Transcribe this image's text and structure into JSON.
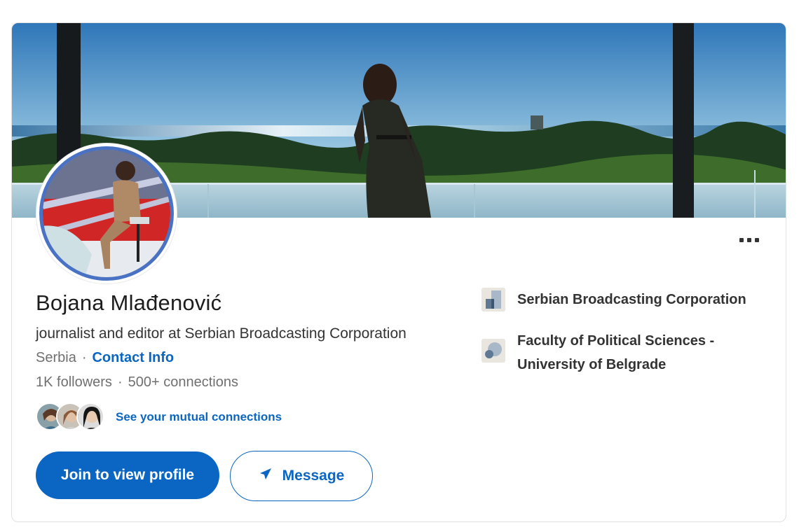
{
  "profile": {
    "name": "Bojana Mlađenović",
    "headline": "journalist and editor at Serbian Broadcasting Corporation",
    "location": "Serbia",
    "contact_label": "Contact Info",
    "followers": "1K followers",
    "connections": "500+ connections",
    "separator": "·"
  },
  "mutual": {
    "link_label": "See your mutual connections"
  },
  "actions": {
    "join_label": "Join to view profile",
    "message_label": "Message"
  },
  "experience": [
    {
      "label": "Serbian Broadcasting Corporation",
      "icon": "company-logo-icon"
    },
    {
      "label": "Faculty of Political Sciences - University of Belgrade",
      "icon": "school-logo-icon"
    }
  ],
  "colors": {
    "accent": "#0a66c2",
    "avatar_ring": "#4a72c4",
    "text_primary": "#1d1d1d",
    "text_secondary": "#707070"
  }
}
